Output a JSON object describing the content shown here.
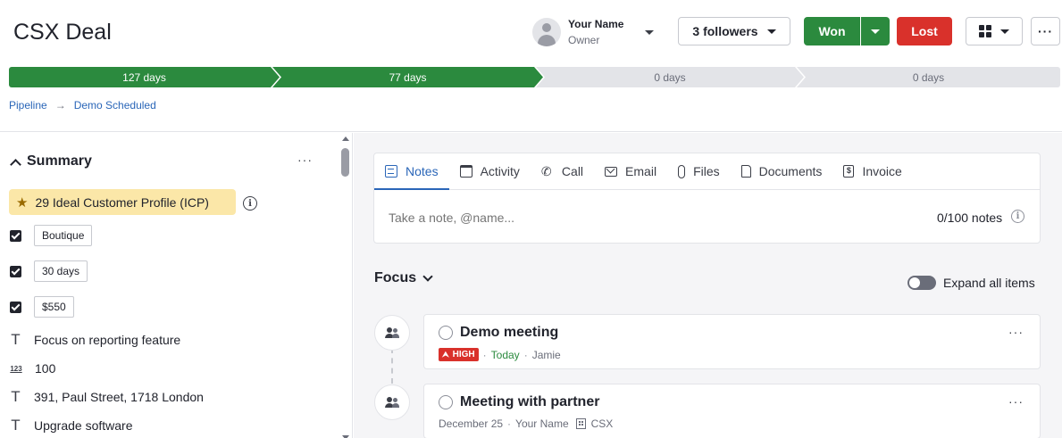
{
  "header": {
    "title": "CSX Deal",
    "owner_name": "Your Name",
    "owner_role": "Owner",
    "followers_label": "3 followers",
    "won_label": "Won",
    "lost_label": "Lost",
    "more_label": "···"
  },
  "stages": [
    {
      "label": "127 days",
      "status": "complete"
    },
    {
      "label": "77 days",
      "status": "current"
    },
    {
      "label": "0 days",
      "status": "pending"
    },
    {
      "label": "0 days",
      "status": "pending"
    }
  ],
  "breadcrumb": [
    "Pipeline",
    "Demo Scheduled"
  ],
  "summary": {
    "title": "Summary",
    "more_label": "···",
    "icp_label": "29 Ideal Customer Profile (ICP)",
    "fields": [
      {
        "type": "checkbox",
        "checked": true,
        "value": "Boutique"
      },
      {
        "type": "checkbox",
        "checked": true,
        "value": "30 days"
      },
      {
        "type": "checkbox",
        "checked": true,
        "value": "$550"
      },
      {
        "type": "text",
        "icon": "text-icon",
        "value": "Focus on reporting feature"
      },
      {
        "type": "number",
        "icon": "number-icon",
        "icon_text": "123",
        "value": "100"
      },
      {
        "type": "text",
        "icon": "text-icon",
        "value": "391, Paul Street, 1718 London"
      },
      {
        "type": "text",
        "icon": "text-icon",
        "value": "Upgrade software"
      }
    ]
  },
  "composer": {
    "tabs": [
      {
        "label": "Notes",
        "icon": "notes-icon",
        "active": true
      },
      {
        "label": "Activity",
        "icon": "calendar-icon",
        "active": false
      },
      {
        "label": "Call",
        "icon": "phone-icon",
        "active": false
      },
      {
        "label": "Email",
        "icon": "email-icon",
        "active": false
      },
      {
        "label": "Files",
        "icon": "paperclip-icon",
        "active": false
      },
      {
        "label": "Documents",
        "icon": "document-icon",
        "active": false
      },
      {
        "label": "Invoice",
        "icon": "invoice-icon",
        "active": false
      }
    ],
    "placeholder": "Take a note, @name...",
    "note_count": "0/100 notes"
  },
  "focus": {
    "title": "Focus",
    "expand_label": "Expand all items",
    "expand_on": false,
    "items": [
      {
        "title": "Demo meeting",
        "priority": "HIGH",
        "date": "Today",
        "person": "Jamie"
      },
      {
        "title": "Meeting with partner",
        "date": "December 25",
        "person": "Your Name",
        "org": "CSX"
      }
    ]
  },
  "colors": {
    "accent": "#2a66b8",
    "won": "#2b8a3e",
    "lost": "#d9312b",
    "icp_bg": "#fbe7a8"
  }
}
